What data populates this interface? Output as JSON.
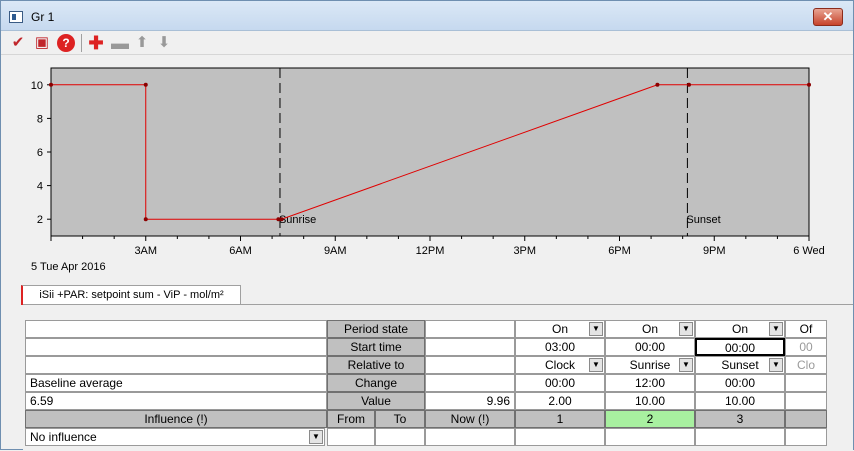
{
  "window": {
    "title": "Gr 1",
    "close_label": "✕"
  },
  "toolbar": [
    "check-icon",
    "print-icon",
    "help-icon",
    "add-icon",
    "remove-icon",
    "move-up-icon",
    "move-down-icon"
  ],
  "chart_data": {
    "type": "line",
    "title": "",
    "xlabel": "",
    "ylabel": "",
    "x_tick_labels": [
      "3AM",
      "6AM",
      "9AM",
      "12PM",
      "3PM",
      "6PM",
      "9PM",
      "6 Wed"
    ],
    "x_date_label": "5 Tue Apr 2016",
    "ylim": [
      1,
      11
    ],
    "y_ticks": [
      2,
      4,
      6,
      8,
      10
    ],
    "xlim_hours": [
      0,
      24
    ],
    "series": [
      {
        "color": "#e00000",
        "points": [
          [
            0,
            10
          ],
          [
            3,
            10
          ],
          [
            3,
            2
          ],
          [
            7.2,
            2
          ],
          [
            7.3,
            2
          ],
          [
            19.2,
            10
          ],
          [
            20.2,
            10
          ],
          [
            24,
            10
          ]
        ]
      }
    ],
    "markers": [
      {
        "label": "Sunrise",
        "hour": 7.25
      },
      {
        "label": "Sunset",
        "hour": 20.15
      }
    ]
  },
  "tab": {
    "label": "iSii +PAR: setpoint sum - ViP - mol/m²"
  },
  "grid": {
    "headers": {
      "period_state": "Period state",
      "start_time": "Start time",
      "relative_to": "Relative to",
      "change": "Change",
      "value": "Value",
      "influence": "Influence (!)",
      "from": "From",
      "to": "To",
      "now": "Now (!)"
    },
    "baseline_label": "Baseline average",
    "baseline_value": "6.59",
    "value_now": "9.96",
    "influence_value": "No influence",
    "columns": [
      {
        "index": "1",
        "state": "On",
        "start": "03:00",
        "relative": "Clock",
        "change": "00:00",
        "value": "2.00"
      },
      {
        "index": "2",
        "state": "On",
        "start": "00:00",
        "relative": "Sunrise",
        "change": "12:00",
        "value": "10.00"
      },
      {
        "index": "3",
        "state": "On",
        "start": "00:00",
        "relative": "Sunset",
        "change": "00:00",
        "value": "10.00"
      },
      {
        "index": "",
        "state": "Of",
        "start": "00",
        "relative": "Clo",
        "change": "",
        "value": ""
      }
    ]
  }
}
